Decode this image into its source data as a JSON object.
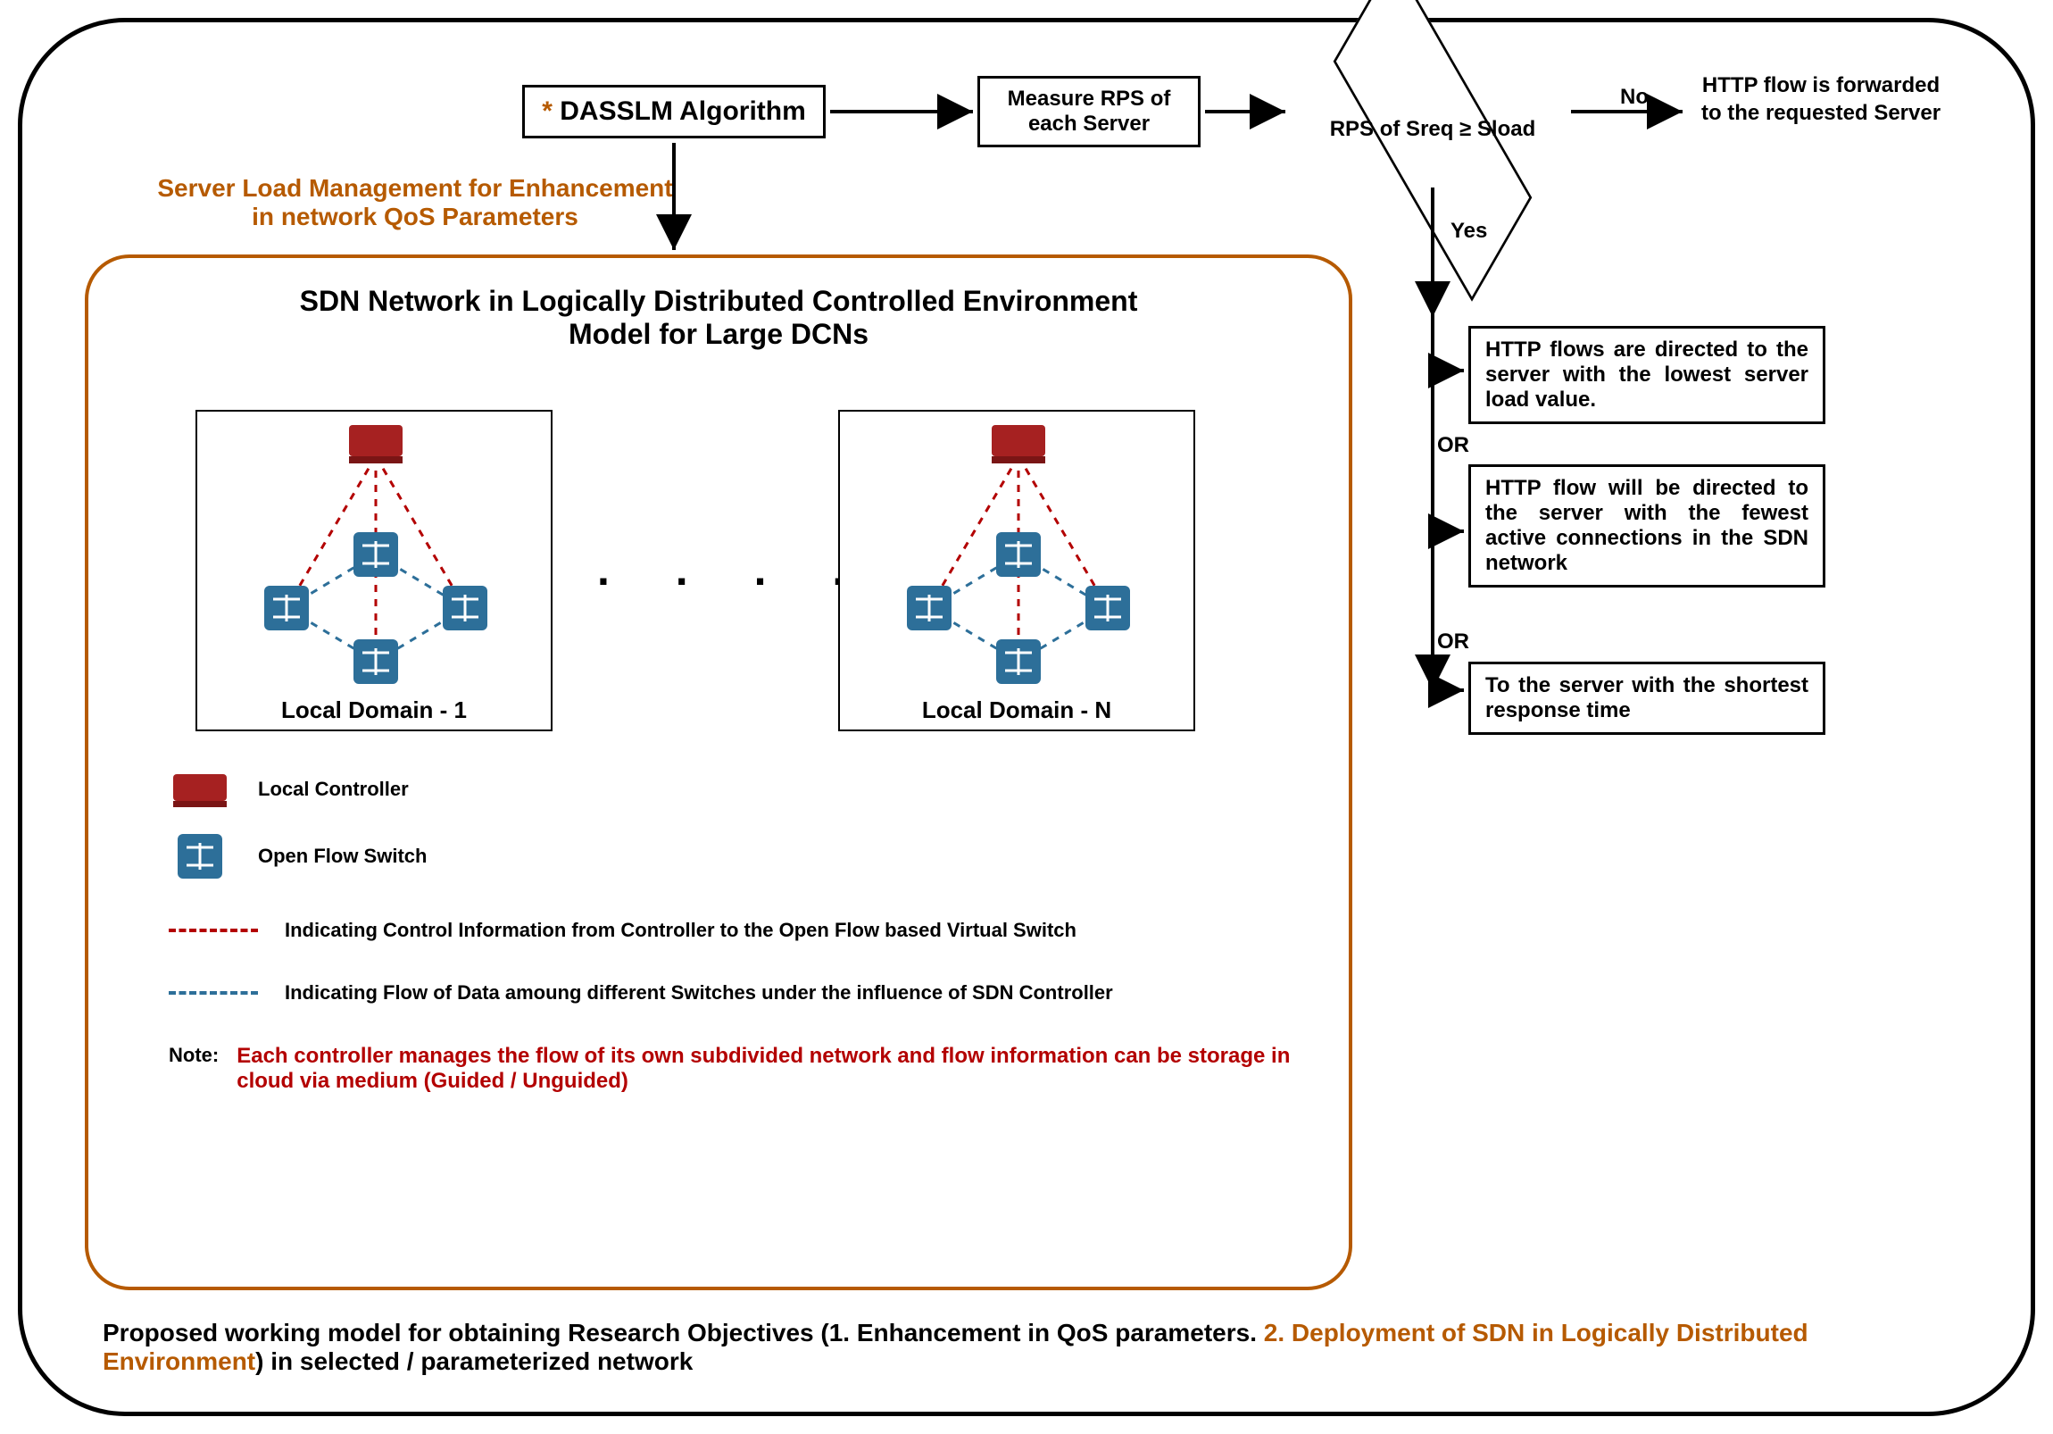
{
  "algo": {
    "asterisk": "*",
    "title": "DASSLM Algorithm"
  },
  "measure": {
    "label": "Measure RPS of each Server"
  },
  "decision": {
    "label": "RPS of Sreq ≥ Sload",
    "no": "No",
    "yes": "Yes"
  },
  "forward": {
    "text": "HTTP flow is forwarded to the requested Server"
  },
  "subtitle": {
    "l1": "Server Load Management for Enhancement",
    "l2": "in network QoS Parameters"
  },
  "model": {
    "title_l1": "SDN Network in Logically Distributed Controlled Environment",
    "title_l2": "Model for Large DCNs",
    "domain1": "Local Domain - 1",
    "domainN": "Local Domain - N",
    "dots": ". . . . ."
  },
  "legend": {
    "controller": "Local Controller",
    "switch": "Open Flow Switch",
    "red_dash": "Indicating Control Information from Controller to the Open Flow based Virtual Switch",
    "blue_dash": "Indicating Flow of Data amoung different Switches under the influence of SDN Controller",
    "note_label": "Note:",
    "note_text": "Each controller manages the flow of its own subdivided network and flow information can be storage in cloud via medium (Guided / Unguided)"
  },
  "options": {
    "opt1": "HTTP flows are directed to the server with the lowest server load value.",
    "opt2": "HTTP flow will be directed to the server with the fewest active connections in the SDN network",
    "opt3": "To the server with the shortest response time",
    "or": "OR"
  },
  "footer": {
    "part1": "Proposed working model for obtaining Research Objectives (1. Enhancement in QoS parameters. ",
    "part2": "2. Deployment of SDN in Logically Distributed Environment",
    "part3": ") in selected / parameterized network"
  }
}
